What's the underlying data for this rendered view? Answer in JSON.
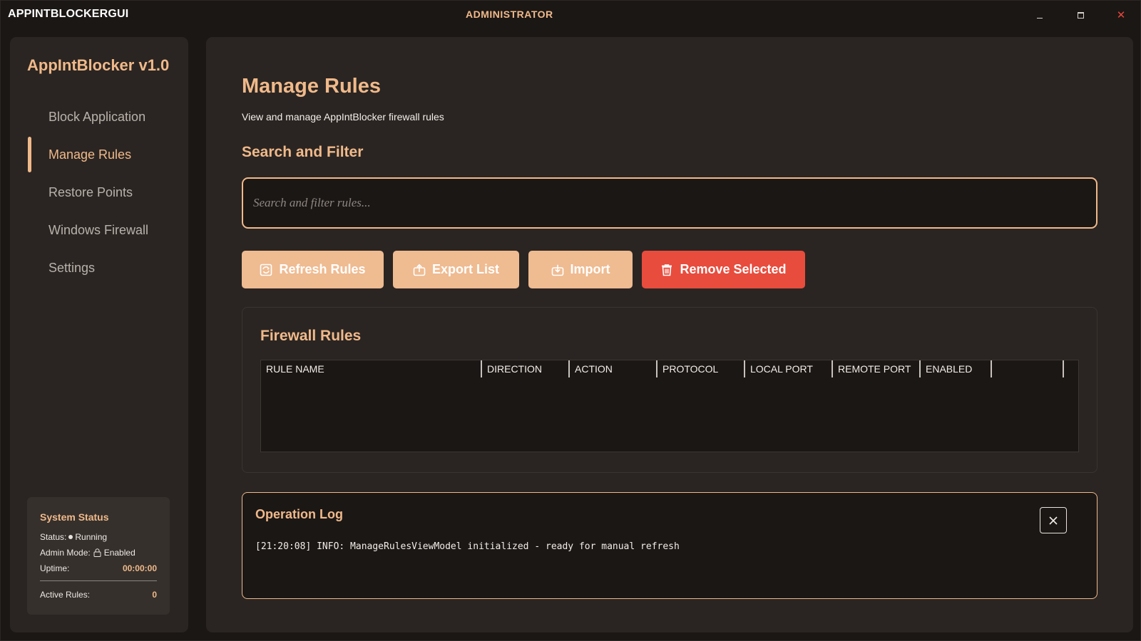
{
  "window": {
    "app_caption": "APPINTBLOCKERGUI",
    "admin_caption": "ADMINISTRATOR",
    "minimize_icon": "minimize-icon",
    "maximize_icon": "maximize-icon",
    "close_icon": "close-icon"
  },
  "sidebar": {
    "title": "AppIntBlocker v1.0",
    "items": [
      {
        "label": "Block Application",
        "active": false
      },
      {
        "label": "Manage Rules",
        "active": true
      },
      {
        "label": "Restore Points",
        "active": false
      },
      {
        "label": "Windows Firewall",
        "active": false
      },
      {
        "label": "Settings",
        "active": false
      }
    ],
    "status": {
      "title": "System Status",
      "status_label": "Status:",
      "status_value": "Running",
      "admin_label": "Admin Mode:",
      "admin_value": "Enabled",
      "uptime_label": "Uptime:",
      "uptime_value": "00:00:00",
      "rules_label": "Active Rules:",
      "rules_value": "0"
    }
  },
  "main": {
    "title": "Manage Rules",
    "subtitle": "View and manage AppIntBlocker firewall rules",
    "search_section_title": "Search and Filter",
    "search": {
      "placeholder": "Search and filter rules...",
      "value": ""
    },
    "buttons": {
      "refresh": "Refresh Rules",
      "export": "Export List",
      "import": "Import",
      "remove": "Remove Selected"
    },
    "rules": {
      "title": "Firewall Rules",
      "columns": [
        "RULE NAME",
        "DIRECTION",
        "ACTION",
        "PROTOCOL",
        "LOCAL PORT",
        "REMOTE PORT",
        "ENABLED"
      ],
      "rows": []
    },
    "log": {
      "title": "Operation Log",
      "lines": [
        "[21:20:08] INFO: ManageRulesViewModel initialized - ready for manual refresh"
      ]
    }
  },
  "colors": {
    "accent": "#f0b98a",
    "danger": "#e84c3d",
    "background": "#1b1715",
    "panel": "#2a2522"
  }
}
